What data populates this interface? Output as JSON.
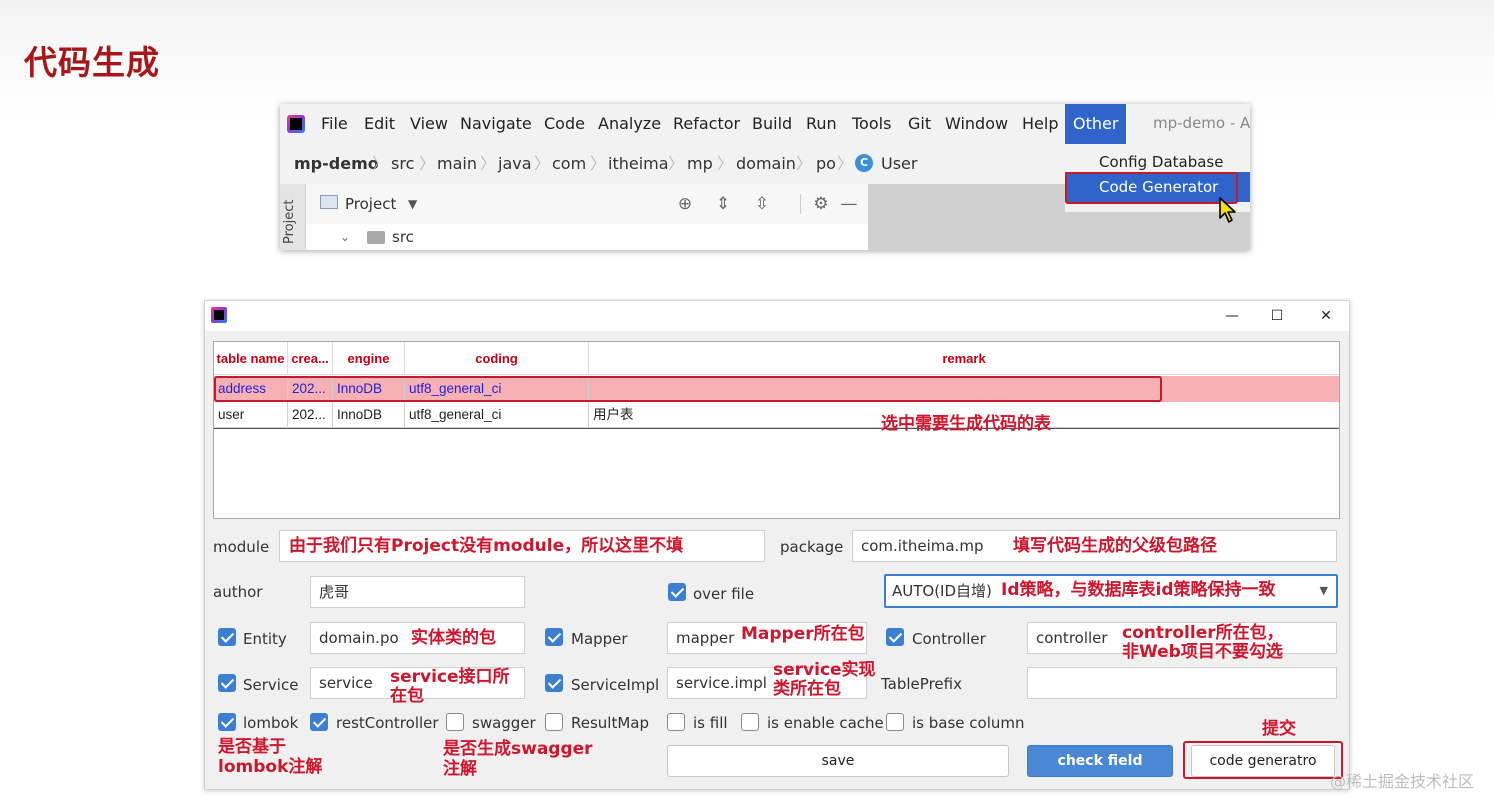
{
  "slide": {
    "title": "代码生成"
  },
  "ide": {
    "menu": [
      "File",
      "Edit",
      "View",
      "Navigate",
      "Code",
      "Analyze",
      "Refactor",
      "Build",
      "Run",
      "Tools",
      "Git",
      "Window",
      "Help"
    ],
    "active_menu": "Other",
    "window_title": "mp-demo - A",
    "breadcrumb": [
      "mp-demo",
      "src",
      "main",
      "java",
      "com",
      "itheima",
      "mp",
      "domain",
      "po"
    ],
    "breadcrumb_sep": "〉",
    "breadcrumb_class": "User",
    "class_icon_letter": "C",
    "dropdown": {
      "items": [
        "Config Database",
        "Code Generator"
      ],
      "selected": "Code Generator"
    },
    "tool_strip_label": "Project",
    "project_panel": {
      "title": "Project",
      "tree_item": "src"
    }
  },
  "dialog": {
    "window_controls": {
      "minimize": "—",
      "maximize": "☐",
      "close": "✕"
    },
    "table": {
      "columns": [
        "table name",
        "crea...",
        "engine",
        "coding",
        "remark"
      ],
      "rows": [
        {
          "name": "address",
          "created": "202...",
          "engine": "InnoDB",
          "coding": "utf8_general_ci",
          "remark": ""
        },
        {
          "name": "user",
          "created": "202...",
          "engine": "InnoDB",
          "coding": "utf8_general_ci",
          "remark": "用户表"
        }
      ],
      "selected_row": 0
    },
    "form": {
      "module_label": "module",
      "module_value": "",
      "package_label": "package",
      "package_value": "com.itheima.mp",
      "author_label": "author",
      "author_value": "虎哥",
      "over_file_label": "over file",
      "over_file_checked": true,
      "id_strategy_value": "AUTO(ID自增)",
      "entity_label": "Entity",
      "entity_checked": true,
      "entity_value": "domain.po",
      "mapper_label": "Mapper",
      "mapper_checked": true,
      "mapper_value": "mapper",
      "controller_label": "Controller",
      "controller_checked": true,
      "controller_value": "controller",
      "service_label": "Service",
      "service_checked": true,
      "service_value": "service",
      "serviceimpl_label": "ServiceImpl",
      "serviceimpl_checked": true,
      "serviceimpl_value": "service.impl",
      "tableprefix_label": "TablePrefix",
      "tableprefix_value": "",
      "lombok_label": "lombok",
      "lombok_checked": true,
      "restcontroller_label": "restController",
      "restcontroller_checked": true,
      "swagger_label": "swagger",
      "swagger_checked": false,
      "resultmap_label": "ResultMap",
      "resultmap_checked": false,
      "isfill_label": "is fill",
      "isfill_checked": false,
      "cache_label": "is enable cache",
      "cache_checked": false,
      "basecolumn_label": "is base column",
      "basecolumn_checked": false
    },
    "buttons": {
      "save": "save",
      "check_field": "check field",
      "generate": "code generatro"
    }
  },
  "annotations": {
    "select_table": "选中需要生成代码的表",
    "module": "由于我们只有Project没有module，所以这里不填",
    "package": "填写代码生成的父级包路径",
    "id_strategy": "Id策略，与数据库表id策略保持一致",
    "entity": "实体类的包",
    "mapper": "Mapper所在包",
    "controller_1": "controller所在包，",
    "controller_2": "非Web项目不要勾选",
    "service_1": "service接口所",
    "service_2": "在包",
    "serviceimpl_1": "service实现",
    "serviceimpl_2": "类所在包",
    "lombok_1": "是否基于",
    "lombok_2": "lombok注解",
    "swagger_1": "是否生成swagger",
    "swagger_2": "注解",
    "submit": "提交"
  },
  "watermark": "@稀土掘金技术社区",
  "colors": {
    "title_red": "#a7171a",
    "annotation_red": "#d0162c",
    "highlight_blue": "#2f65ca",
    "row_selected": "#f7b0b3"
  }
}
